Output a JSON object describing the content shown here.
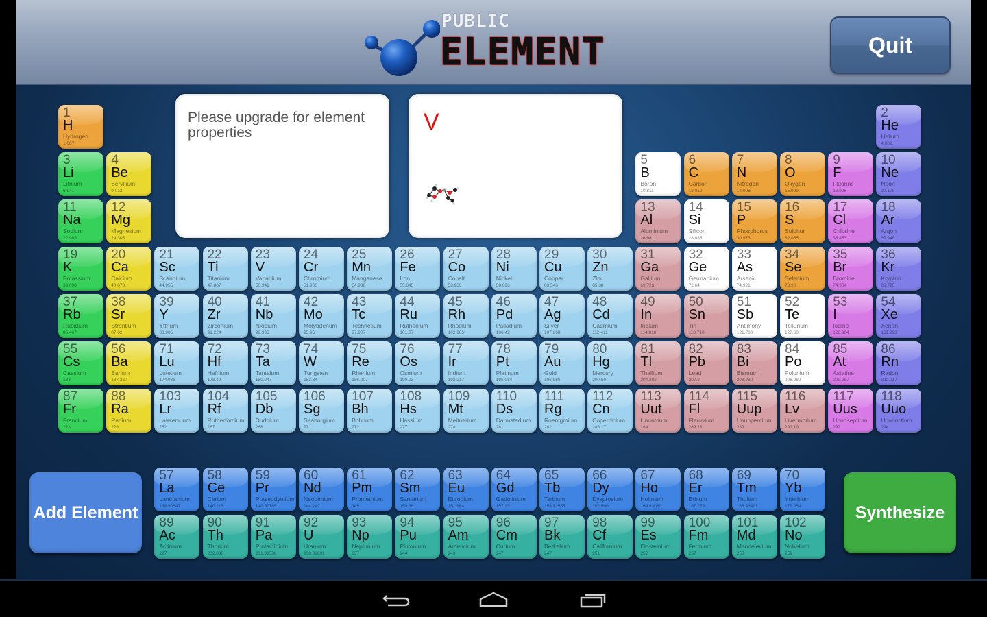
{
  "header": {
    "logo_top": "PUBLIC",
    "logo_main": "ELEMENT",
    "quit_label": "Quit"
  },
  "properties_panel": {
    "message": "Please upgrade for element properties"
  },
  "preview_panel": {
    "symbol": "V",
    "molecule_icon": "molecule-icon"
  },
  "buttons": {
    "add_element": "Add Element",
    "synthesize": "Synthesize"
  },
  "colors": {
    "alkali": "#35d15a",
    "alkaline": "#e8d830",
    "transition": "#9fd2ee",
    "post_transition": "#d49ea4",
    "metalloid": "#ffffff",
    "nonmetal": "#eca33c",
    "halogen": "#d77ae6",
    "noble": "#7f7ee8",
    "lanthanide": "#3f84e3",
    "actinide": "#36b0a0"
  },
  "elements": [
    {
      "n": "1",
      "s": "H",
      "name": "Hydrogen",
      "m": "1.007",
      "c": "nonmetal",
      "r": 0,
      "col": 0
    },
    {
      "n": "2",
      "s": "He",
      "name": "Helium",
      "m": "4.002",
      "c": "noble",
      "r": 0,
      "col": 17
    },
    {
      "n": "3",
      "s": "Li",
      "name": "Lithium",
      "m": "6.941",
      "c": "alkali",
      "r": 1,
      "col": 0
    },
    {
      "n": "4",
      "s": "Be",
      "name": "Beryllium",
      "m": "9.012",
      "c": "alkaline",
      "r": 1,
      "col": 1
    },
    {
      "n": "5",
      "s": "B",
      "name": "Boron",
      "m": "10.811",
      "c": "metalloid",
      "r": 1,
      "col": 12
    },
    {
      "n": "6",
      "s": "C",
      "name": "Carbon",
      "m": "12.010",
      "c": "nonmetal",
      "r": 1,
      "col": 13
    },
    {
      "n": "7",
      "s": "N",
      "name": "Nitrogen",
      "m": "14.006",
      "c": "nonmetal",
      "r": 1,
      "col": 14
    },
    {
      "n": "8",
      "s": "O",
      "name": "Oxygen",
      "m": "15.999",
      "c": "nonmetal",
      "r": 1,
      "col": 15
    },
    {
      "n": "9",
      "s": "F",
      "name": "Fluorine",
      "m": "18.996",
      "c": "halogen",
      "r": 1,
      "col": 16
    },
    {
      "n": "10",
      "s": "Ne",
      "name": "Neon",
      "m": "20.179",
      "c": "noble",
      "r": 1,
      "col": 17
    },
    {
      "n": "11",
      "s": "Na",
      "name": "Sodium",
      "m": "22.989",
      "c": "alkali",
      "r": 2,
      "col": 0
    },
    {
      "n": "12",
      "s": "Mg",
      "name": "Magnesium",
      "m": "24.305",
      "c": "alkaline",
      "r": 2,
      "col": 1
    },
    {
      "n": "13",
      "s": "Al",
      "name": "Aluminium",
      "m": "26.981",
      "c": "post_transition",
      "r": 2,
      "col": 12
    },
    {
      "n": "14",
      "s": "Si",
      "name": "Silicon",
      "m": "28.085",
      "c": "metalloid",
      "r": 2,
      "col": 13
    },
    {
      "n": "15",
      "s": "P",
      "name": "Phosphorus",
      "m": "30.973",
      "c": "nonmetal",
      "r": 2,
      "col": 14
    },
    {
      "n": "16",
      "s": "S",
      "name": "Sulphur",
      "m": "32.065",
      "c": "nonmetal",
      "r": 2,
      "col": 15
    },
    {
      "n": "17",
      "s": "Cl",
      "name": "Chlorine",
      "m": "35.453",
      "c": "halogen",
      "r": 2,
      "col": 16
    },
    {
      "n": "18",
      "s": "Ar",
      "name": "Argon",
      "m": "39.948",
      "c": "noble",
      "r": 2,
      "col": 17
    },
    {
      "n": "19",
      "s": "K",
      "name": "Potassium",
      "m": "39.098",
      "c": "alkali",
      "r": 3,
      "col": 0
    },
    {
      "n": "20",
      "s": "Ca",
      "name": "Calcium",
      "m": "40.078",
      "c": "alkaline",
      "r": 3,
      "col": 1
    },
    {
      "n": "21",
      "s": "Sc",
      "name": "Scandium",
      "m": "44.955",
      "c": "transition",
      "r": 3,
      "col": 2
    },
    {
      "n": "22",
      "s": "Ti",
      "name": "Titanium",
      "m": "47.867",
      "c": "transition",
      "r": 3,
      "col": 3
    },
    {
      "n": "23",
      "s": "V",
      "name": "Vanadium",
      "m": "50.941",
      "c": "transition",
      "r": 3,
      "col": 4
    },
    {
      "n": "24",
      "s": "Cr",
      "name": "Chromium",
      "m": "51.966",
      "c": "transition",
      "r": 3,
      "col": 5
    },
    {
      "n": "25",
      "s": "Mn",
      "name": "Manganese",
      "m": "54.938",
      "c": "transition",
      "r": 3,
      "col": 6
    },
    {
      "n": "26",
      "s": "Fe",
      "name": "Iron",
      "m": "55.845",
      "c": "transition",
      "r": 3,
      "col": 7
    },
    {
      "n": "27",
      "s": "Co",
      "name": "Cobalt",
      "m": "58.933",
      "c": "transition",
      "r": 3,
      "col": 8
    },
    {
      "n": "28",
      "s": "Ni",
      "name": "Nickel",
      "m": "58.693",
      "c": "transition",
      "r": 3,
      "col": 9
    },
    {
      "n": "29",
      "s": "Cu",
      "name": "Copper",
      "m": "63.546",
      "c": "transition",
      "r": 3,
      "col": 10
    },
    {
      "n": "30",
      "s": "Zn",
      "name": "Zinc",
      "m": "65.38",
      "c": "transition",
      "r": 3,
      "col": 11
    },
    {
      "n": "31",
      "s": "Ga",
      "name": "Gallium",
      "m": "69.723",
      "c": "post_transition",
      "r": 3,
      "col": 12
    },
    {
      "n": "32",
      "s": "Ge",
      "name": "Germanium",
      "m": "72.64",
      "c": "metalloid",
      "r": 3,
      "col": 13
    },
    {
      "n": "33",
      "s": "As",
      "name": "Arsenic",
      "m": "74.921",
      "c": "metalloid",
      "r": 3,
      "col": 14
    },
    {
      "n": "34",
      "s": "Se",
      "name": "Selenium",
      "m": "78.96",
      "c": "nonmetal",
      "r": 3,
      "col": 15
    },
    {
      "n": "35",
      "s": "Br",
      "name": "Bromide",
      "m": "74.904",
      "c": "halogen",
      "r": 3,
      "col": 16
    },
    {
      "n": "36",
      "s": "Kr",
      "name": "Krypton",
      "m": "83.795",
      "c": "noble",
      "r": 3,
      "col": 17
    },
    {
      "n": "37",
      "s": "Rb",
      "name": "Rubidium",
      "m": "85.467",
      "c": "alkali",
      "r": 4,
      "col": 0
    },
    {
      "n": "38",
      "s": "Sr",
      "name": "Strontium",
      "m": "87.62",
      "c": "alkaline",
      "r": 4,
      "col": 1
    },
    {
      "n": "39",
      "s": "Y",
      "name": "Yttrium",
      "m": "88.905",
      "c": "transition",
      "r": 4,
      "col": 2
    },
    {
      "n": "40",
      "s": "Zr",
      "name": "Zirconium",
      "m": "91.224",
      "c": "transition",
      "r": 4,
      "col": 3
    },
    {
      "n": "41",
      "s": "Nb",
      "name": "Niobium",
      "m": "92.906",
      "c": "transition",
      "r": 4,
      "col": 4
    },
    {
      "n": "42",
      "s": "Mo",
      "name": "Molybdenum",
      "m": "95.96",
      "c": "transition",
      "r": 4,
      "col": 5
    },
    {
      "n": "43",
      "s": "Tc",
      "name": "Technetium",
      "m": "97.907",
      "c": "transition",
      "r": 4,
      "col": 6
    },
    {
      "n": "44",
      "s": "Ru",
      "name": "Ruthenium",
      "m": "101.07",
      "c": "transition",
      "r": 4,
      "col": 7
    },
    {
      "n": "45",
      "s": "Rh",
      "name": "Rhodium",
      "m": "102.905",
      "c": "transition",
      "r": 4,
      "col": 8
    },
    {
      "n": "46",
      "s": "Pd",
      "name": "Palladium",
      "m": "106.42",
      "c": "transition",
      "r": 4,
      "col": 9
    },
    {
      "n": "47",
      "s": "Ag",
      "name": "Silver",
      "m": "107.868",
      "c": "transition",
      "r": 4,
      "col": 10
    },
    {
      "n": "48",
      "s": "Cd",
      "name": "Cadmium",
      "m": "112.411",
      "c": "transition",
      "r": 4,
      "col": 11
    },
    {
      "n": "49",
      "s": "In",
      "name": "Indium",
      "m": "114.818",
      "c": "post_transition",
      "r": 4,
      "col": 12
    },
    {
      "n": "50",
      "s": "Sn",
      "name": "Tin",
      "m": "118.710",
      "c": "post_transition",
      "r": 4,
      "col": 13
    },
    {
      "n": "51",
      "s": "Sb",
      "name": "Antimony",
      "m": "121.760",
      "c": "metalloid",
      "r": 4,
      "col": 14
    },
    {
      "n": "52",
      "s": "Te",
      "name": "Tellurium",
      "m": "127.60",
      "c": "metalloid",
      "r": 4,
      "col": 15
    },
    {
      "n": "53",
      "s": "I",
      "name": "Iodine",
      "m": "126.904",
      "c": "halogen",
      "r": 4,
      "col": 16
    },
    {
      "n": "54",
      "s": "Xe",
      "name": "Xenon",
      "m": "131.293",
      "c": "noble",
      "r": 4,
      "col": 17
    },
    {
      "n": "55",
      "s": "Cs",
      "name": "Caesium",
      "m": "133",
      "c": "alkali",
      "r": 5,
      "col": 0
    },
    {
      "n": "56",
      "s": "Ba",
      "name": "Barium",
      "m": "137.327",
      "c": "alkaline",
      "r": 5,
      "col": 1
    },
    {
      "n": "71",
      "s": "Lu",
      "name": "Lutetium",
      "m": "174.986",
      "c": "transition",
      "r": 5,
      "col": 2
    },
    {
      "n": "72",
      "s": "Hf",
      "name": "Hafnium",
      "m": "178.49",
      "c": "transition",
      "r": 5,
      "col": 3
    },
    {
      "n": "73",
      "s": "Ta",
      "name": "Tantalum",
      "m": "180.947",
      "c": "transition",
      "r": 5,
      "col": 4
    },
    {
      "n": "74",
      "s": "W",
      "name": "Tungsten",
      "m": "183.84",
      "c": "transition",
      "r": 5,
      "col": 5
    },
    {
      "n": "75",
      "s": "Re",
      "name": "Rhenium",
      "m": "186.207",
      "c": "transition",
      "r": 5,
      "col": 6
    },
    {
      "n": "76",
      "s": "Os",
      "name": "Osmium",
      "m": "190.23",
      "c": "transition",
      "r": 5,
      "col": 7
    },
    {
      "n": "77",
      "s": "Ir",
      "name": "Iridium",
      "m": "192.217",
      "c": "transition",
      "r": 5,
      "col": 8
    },
    {
      "n": "78",
      "s": "Pt",
      "name": "Platinum",
      "m": "195.084",
      "c": "transition",
      "r": 5,
      "col": 9
    },
    {
      "n": "79",
      "s": "Au",
      "name": "Gold",
      "m": "196.966",
      "c": "transition",
      "r": 5,
      "col": 10
    },
    {
      "n": "80",
      "s": "Hg",
      "name": "Mercury",
      "m": "200.59",
      "c": "transition",
      "r": 5,
      "col": 11
    },
    {
      "n": "81",
      "s": "Tl",
      "name": "Thallium",
      "m": "204.383",
      "c": "post_transition",
      "r": 5,
      "col": 12
    },
    {
      "n": "82",
      "s": "Pb",
      "name": "Lead",
      "m": "207.2",
      "c": "post_transition",
      "r": 5,
      "col": 13
    },
    {
      "n": "83",
      "s": "Bi",
      "name": "Bismuth",
      "m": "208.980",
      "c": "post_transition",
      "r": 5,
      "col": 14
    },
    {
      "n": "84",
      "s": "Po",
      "name": "Polonium",
      "m": "208.982",
      "c": "metalloid",
      "r": 5,
      "col": 15
    },
    {
      "n": "85",
      "s": "At",
      "name": "Astatine",
      "m": "209.987",
      "c": "halogen",
      "r": 5,
      "col": 16
    },
    {
      "n": "86",
      "s": "Rn",
      "name": "Radon",
      "m": "222.017",
      "c": "noble",
      "r": 5,
      "col": 17
    },
    {
      "n": "87",
      "s": "Fr",
      "name": "Francium",
      "m": "223",
      "c": "alkali",
      "r": 6,
      "col": 0
    },
    {
      "n": "88",
      "s": "Ra",
      "name": "Radium",
      "m": "226",
      "c": "alkaline",
      "r": 6,
      "col": 1
    },
    {
      "n": "103",
      "s": "Lr",
      "name": "Lawrencium",
      "m": "262",
      "c": "transition",
      "r": 6,
      "col": 2
    },
    {
      "n": "104",
      "s": "Rf",
      "name": "Rutherfordium",
      "m": "267",
      "c": "transition",
      "r": 6,
      "col": 3
    },
    {
      "n": "105",
      "s": "Db",
      "name": "Dudnium",
      "m": "268",
      "c": "transition",
      "r": 6,
      "col": 4
    },
    {
      "n": "106",
      "s": "Sg",
      "name": "Seaborgium",
      "m": "271",
      "c": "transition",
      "r": 6,
      "col": 5
    },
    {
      "n": "107",
      "s": "Bh",
      "name": "Bohrium",
      "m": "272",
      "c": "transition",
      "r": 6,
      "col": 6
    },
    {
      "n": "108",
      "s": "Hs",
      "name": "Hassium",
      "m": "277",
      "c": "transition",
      "r": 6,
      "col": 7
    },
    {
      "n": "109",
      "s": "Mt",
      "name": "Meitnerium",
      "m": "278",
      "c": "transition",
      "r": 6,
      "col": 8
    },
    {
      "n": "110",
      "s": "Ds",
      "name": "Darmstadium",
      "m": "281",
      "c": "transition",
      "r": 6,
      "col": 9
    },
    {
      "n": "111",
      "s": "Rg",
      "name": "Roentgmium",
      "m": "282",
      "c": "transition",
      "r": 6,
      "col": 10
    },
    {
      "n": "112",
      "s": "Cn",
      "name": "Copernicium",
      "m": "285.17",
      "c": "transition",
      "r": 6,
      "col": 11
    },
    {
      "n": "113",
      "s": "Uut",
      "name": "Ununtrium",
      "m": "284",
      "c": "post_transition",
      "r": 6,
      "col": 12
    },
    {
      "n": "114",
      "s": "Fl",
      "name": "Flerovium",
      "m": "289.18",
      "c": "post_transition",
      "r": 6,
      "col": 13
    },
    {
      "n": "115",
      "s": "Uup",
      "name": "Ununpentium",
      "m": "289",
      "c": "post_transition",
      "r": 6,
      "col": 14
    },
    {
      "n": "116",
      "s": "Lv",
      "name": "Livermorium",
      "m": "293.19",
      "c": "post_transition",
      "r": 6,
      "col": 15
    },
    {
      "n": "117",
      "s": "Uus",
      "name": "Ununseptium",
      "m": "297",
      "c": "halogen",
      "r": 6,
      "col": 16
    },
    {
      "n": "118",
      "s": "Uuo",
      "name": "Ununoctium",
      "m": "294",
      "c": "noble",
      "r": 6,
      "col": 17
    },
    {
      "n": "57",
      "s": "La",
      "name": "Lanthanium",
      "m": "138.90547",
      "c": "lanthanide",
      "r": 7,
      "col": 2
    },
    {
      "n": "58",
      "s": "Ce",
      "name": "Cerium",
      "m": "140.116",
      "c": "lanthanide",
      "r": 7,
      "col": 3
    },
    {
      "n": "59",
      "s": "Pr",
      "name": "Praseodymium",
      "m": "140.90765",
      "c": "lanthanide",
      "r": 7,
      "col": 4
    },
    {
      "n": "60",
      "s": "Nd",
      "name": "Neodimium",
      "m": "144.242",
      "c": "lanthanide",
      "r": 7,
      "col": 5
    },
    {
      "n": "61",
      "s": "Pm",
      "name": "Promethium",
      "m": "145",
      "c": "lanthanide",
      "r": 7,
      "col": 6
    },
    {
      "n": "62",
      "s": "Sm",
      "name": "Samarium",
      "m": "150.36",
      "c": "lanthanide",
      "r": 7,
      "col": 7
    },
    {
      "n": "63",
      "s": "Eu",
      "name": "Europium",
      "m": "151.964",
      "c": "lanthanide",
      "r": 7,
      "col": 8
    },
    {
      "n": "64",
      "s": "Gd",
      "name": "Gadolinium",
      "m": "157.25",
      "c": "lanthanide",
      "r": 7,
      "col": 9
    },
    {
      "n": "65",
      "s": "Tb",
      "name": "Terbium",
      "m": "158.92535",
      "c": "lanthanide",
      "r": 7,
      "col": 10
    },
    {
      "n": "66",
      "s": "Dy",
      "name": "Dysprosium",
      "m": "162.500",
      "c": "lanthanide",
      "r": 7,
      "col": 11
    },
    {
      "n": "67",
      "s": "Ho",
      "name": "Holmium",
      "m": "164.93032",
      "c": "lanthanide",
      "r": 7,
      "col": 12
    },
    {
      "n": "68",
      "s": "Er",
      "name": "Erbium",
      "m": "167.259",
      "c": "lanthanide",
      "r": 7,
      "col": 13
    },
    {
      "n": "69",
      "s": "Tm",
      "name": "Thulium",
      "m": "168.93421",
      "c": "lanthanide",
      "r": 7,
      "col": 14
    },
    {
      "n": "70",
      "s": "Yb",
      "name": "Ytterbium",
      "m": "173.054",
      "c": "lanthanide",
      "r": 7,
      "col": 15
    },
    {
      "n": "89",
      "s": "Ac",
      "name": "Actinium",
      "m": "227",
      "c": "actinide",
      "r": 8,
      "col": 2
    },
    {
      "n": "90",
      "s": "Th",
      "name": "Thorium",
      "m": "232.038",
      "c": "actinide",
      "r": 8,
      "col": 3
    },
    {
      "n": "91",
      "s": "Pa",
      "name": "Protactinium",
      "m": "231.03588",
      "c": "actinide",
      "r": 8,
      "col": 4
    },
    {
      "n": "92",
      "s": "U",
      "name": "Uranium",
      "m": "238.02891",
      "c": "actinide",
      "r": 8,
      "col": 5
    },
    {
      "n": "93",
      "s": "Np",
      "name": "Neptunium",
      "m": "237",
      "c": "actinide",
      "r": 8,
      "col": 6
    },
    {
      "n": "94",
      "s": "Pu",
      "name": "Plutonium",
      "m": "244",
      "c": "actinide",
      "r": 8,
      "col": 7
    },
    {
      "n": "95",
      "s": "Am",
      "name": "Americium",
      "m": "243",
      "c": "actinide",
      "r": 8,
      "col": 8
    },
    {
      "n": "96",
      "s": "Cm",
      "name": "Curium",
      "m": "247",
      "c": "actinide",
      "r": 8,
      "col": 9
    },
    {
      "n": "97",
      "s": "Bk",
      "name": "Berkelium",
      "m": "247",
      "c": "actinide",
      "r": 8,
      "col": 10
    },
    {
      "n": "98",
      "s": "Cf",
      "name": "Californium",
      "m": "251",
      "c": "actinide",
      "r": 8,
      "col": 11
    },
    {
      "n": "99",
      "s": "Es",
      "name": "Einsteinium",
      "m": "252",
      "c": "actinide",
      "r": 8,
      "col": 12
    },
    {
      "n": "100",
      "s": "Fm",
      "name": "Fermium",
      "m": "257",
      "c": "actinide",
      "r": 8,
      "col": 13
    },
    {
      "n": "101",
      "s": "Md",
      "name": "Mendelevium",
      "m": "258",
      "c": "actinide",
      "r": 8,
      "col": 14
    },
    {
      "n": "102",
      "s": "No",
      "name": "Nobelium",
      "m": "259",
      "c": "actinide",
      "r": 8,
      "col": 15
    }
  ],
  "navbar": {
    "back_icon": "back-icon",
    "home_icon": "home-icon",
    "recents_icon": "recents-icon"
  }
}
